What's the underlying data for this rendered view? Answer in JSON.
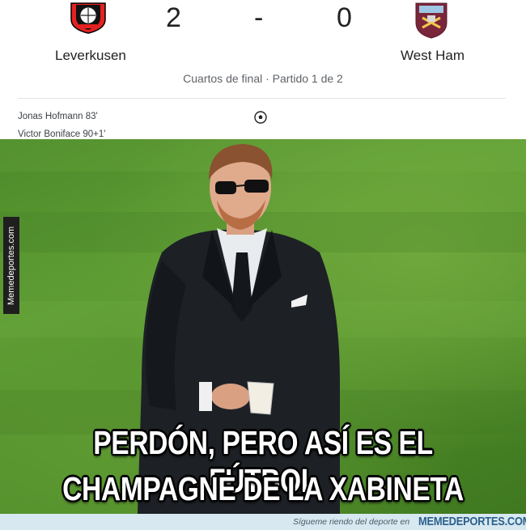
{
  "match": {
    "home": {
      "team": "Leverkusen",
      "score": "2",
      "logo_icon": "bayer-leverkusen-crest-icon"
    },
    "separator": "-",
    "away": {
      "team": "West Ham",
      "score": "0",
      "logo_icon": "west-ham-crest-icon"
    },
    "round": "Cuartos de final · Partido 1 de 2",
    "scorers": [
      {
        "text": "Jonas Hofmann 83'"
      },
      {
        "text": "Victor Boniface 90+1'"
      }
    ],
    "goal_icon": "soccer-ball-icon"
  },
  "meme": {
    "caption_line1": "PERDÓN, PERO ASÍ ES EL FÚTBOL",
    "caption_line2": "CHAMPAGNE DE LA XABINETA",
    "side_watermark": "Memedeportes.com"
  },
  "footer": {
    "follow_text": "Sígueте riendo del deporte en",
    "brand": "MEMEDEPORTES.COM"
  },
  "colors": {
    "grass": "#4d8a2a",
    "footer_bg": "#d7e8f1",
    "brand": "#2b5f8a",
    "leverkusen_red": "#e32221",
    "westham_claret": "#7a263a"
  }
}
